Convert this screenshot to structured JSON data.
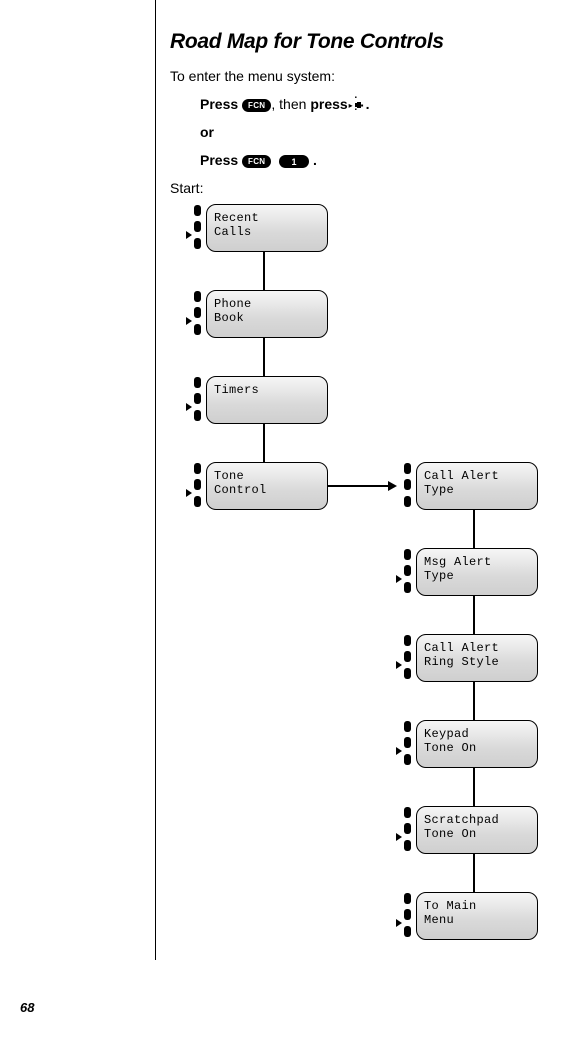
{
  "heading": "Road Map for Tone Controls",
  "intro": "To enter the menu system:",
  "steps": {
    "line1_prefix": "Press ",
    "fcn": "FCN",
    "line1_mid": ", then ",
    "line1_press": "press ",
    "line1_end": ".",
    "or": "or",
    "line2_prefix": "Press ",
    "one": "1",
    "line2_end": " ."
  },
  "start_label": "Start:",
  "menu_left": {
    "0": "Recent\nCalls",
    "1": "Phone\nBook",
    "2": "Timers",
    "3": "Tone\nControl"
  },
  "menu_right": {
    "0": "Call Alert\nType",
    "1": "Msg Alert\nType",
    "2": "Call Alert\nRing Style",
    "3": "Keypad\nTone On",
    "4": "Scratchpad\nTone On",
    "5": "To Main\nMenu"
  },
  "page_number": "68"
}
